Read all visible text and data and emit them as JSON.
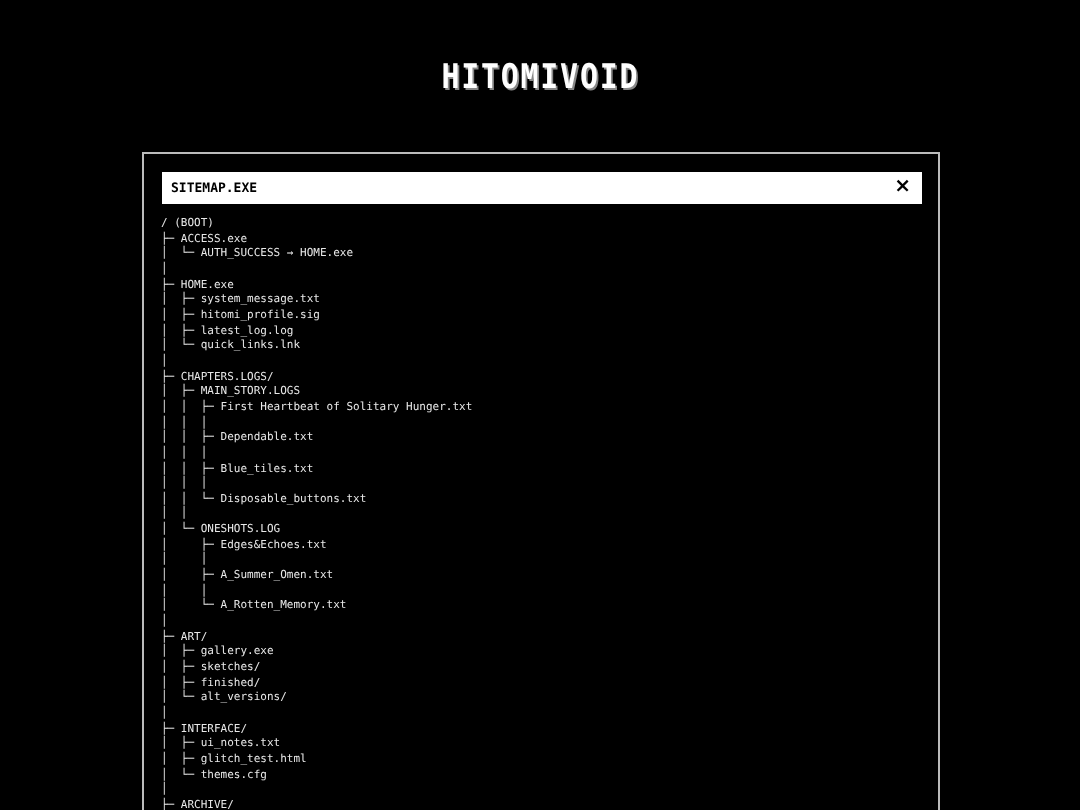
{
  "logo": "HITOMIVOID",
  "window": {
    "title": "SITEMAP.EXE",
    "close": "×"
  },
  "listing": [
    "/ (BOOT)",
    "├─ ACCESS.exe",
    "│  └─ AUTH_SUCCESS → HOME.exe",
    "│",
    "├─ HOME.exe",
    "│  ├─ system_message.txt",
    "│  ├─ hitomi_profile.sig",
    "│  ├─ latest_log.log",
    "│  └─ quick_links.lnk",
    "│",
    "├─ CHAPTERS.LOGS/",
    "│  ├─ MAIN_STORY.LOGS",
    "│  │  ├─ First Heartbeat of Solitary Hunger.txt",
    "│  │  │",
    "│  │  ├─ Dependable.txt",
    "│  │  │",
    "│  │  ├─ Blue_tiles.txt",
    "│  │  │",
    "│  │  └─ Disposable_buttons.txt",
    "│  │",
    "│  └─ ONESHOTS.LOG",
    "│     ├─ Edges&Echoes.txt",
    "│     │",
    "│     ├─ A_Summer_Omen.txt",
    "│     │",
    "│     └─ A_Rotten_Memory.txt",
    "│",
    "├─ ART/",
    "│  ├─ gallery.exe",
    "│  ├─ sketches/",
    "│  ├─ finished/",
    "│  └─ alt_versions/",
    "│",
    "├─ INTERFACE/",
    "│  ├─ ui_notes.txt",
    "│  ├─ glitch_test.html",
    "│  └─ themes.cfg",
    "│",
    "├─ ARCHIVE/"
  ]
}
